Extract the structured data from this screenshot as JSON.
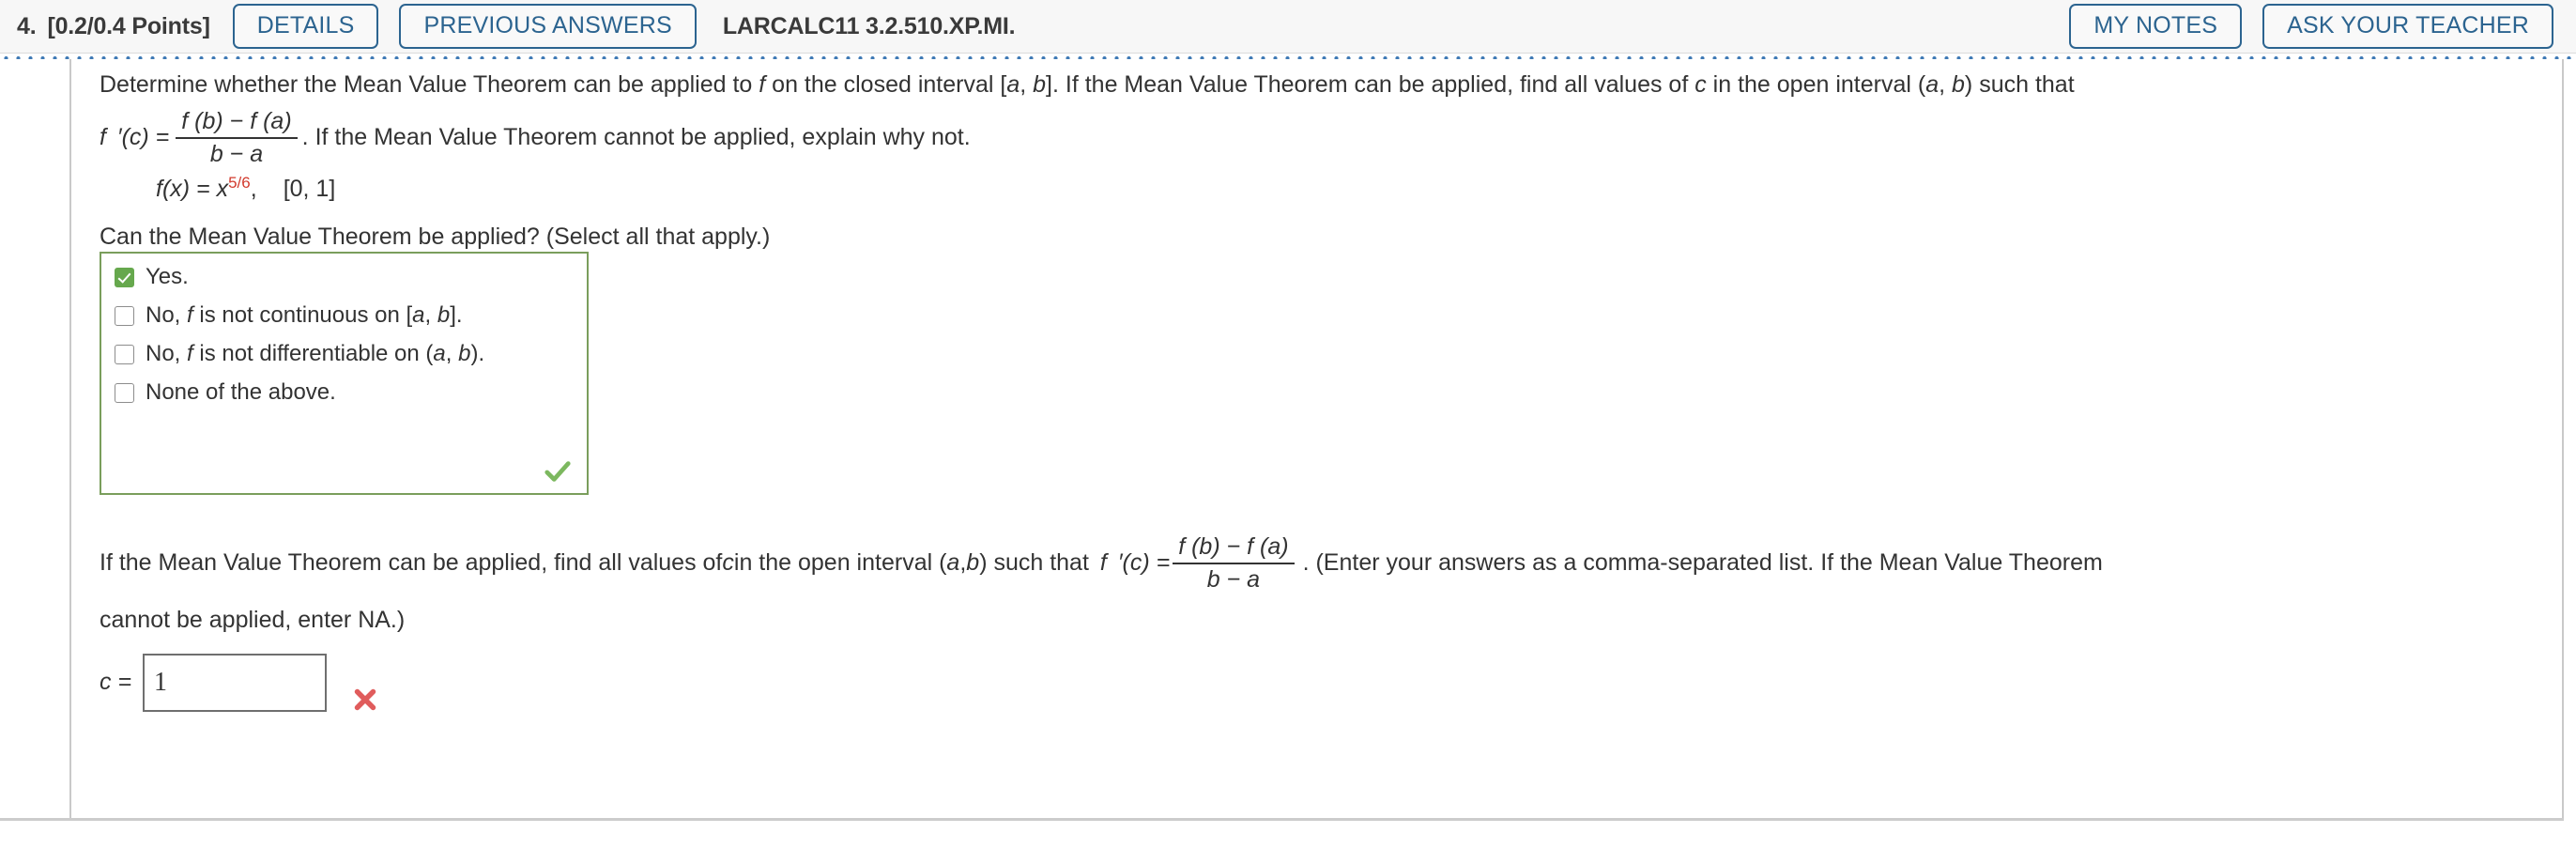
{
  "header": {
    "question_number": "4.",
    "points": "[0.2/0.4 Points]",
    "details_label": "DETAILS",
    "previous_answers_label": "PREVIOUS ANSWERS",
    "assignment_title": "LARCALC11 3.2.510.XP.MI.",
    "my_notes_label": "MY NOTES",
    "ask_your_teacher_label": "ASK YOUR TEACHER"
  },
  "problem": {
    "line1_a": "Determine whether the Mean Value Theorem can be applied to ",
    "line1_f": "f",
    "line1_b": " on the closed interval [",
    "line1_a_var": "a",
    "line1_c": ", ",
    "line1_b_var": "b",
    "line1_d": "]. If the Mean Value Theorem can be applied, find all values of ",
    "line1_c_var": "c",
    "line1_e": " in the open interval (",
    "line1_a_var2": "a",
    "line1_f2": ", ",
    "line1_b_var2": "b",
    "line1_g": ") such that",
    "line2_lead": "f  ′(c) =",
    "frac_num": "f (b) − f (a)",
    "frac_den": "b − a",
    "line2_tail": ".  If the Mean Value Theorem cannot be applied, explain why not.",
    "fx_label": "f(x) = x",
    "fx_exponent": "5/6",
    "fx_comma": ",",
    "fx_interval": "[0, 1]",
    "select_prompt": "Can the Mean Value Theorem be applied? (Select all that apply.)"
  },
  "options": [
    {
      "label": "Yes.",
      "checked": true
    },
    {
      "label": "No, f is not continuous on [a, b].",
      "checked": false
    },
    {
      "label": "No, f is not differentiable on (a, b).",
      "checked": false
    },
    {
      "label": "None of the above.",
      "checked": false
    }
  ],
  "options_feedback": "correct-check",
  "question2": {
    "part_a": "If the Mean Value Theorem can be applied, find all values of ",
    "var_c": "c",
    "part_b": " in the open interval (",
    "var_a": "a",
    "comma": ", ",
    "var_b": "b",
    "part_c": ") such that",
    "fprime": "f  ′(c) =",
    "frac_num": "f (b) − f (a)",
    "frac_den": "b − a",
    "part_d": ". (Enter your answers as a comma-separated list. If the Mean Value Theorem",
    "line2": "cannot be applied, enter NA.)",
    "answer_label": "c =",
    "answer_value": "1",
    "answer_placeholder": "",
    "answer_feedback": "incorrect-x"
  },
  "colors": {
    "accent_blue": "#2c6490",
    "correct_green": "#66a84d",
    "box_border_green": "#7a9e5c",
    "incorrect_red": "#e05c5c",
    "exponent_red": "#d23b2e",
    "header_bg": "#f7f7f7"
  }
}
